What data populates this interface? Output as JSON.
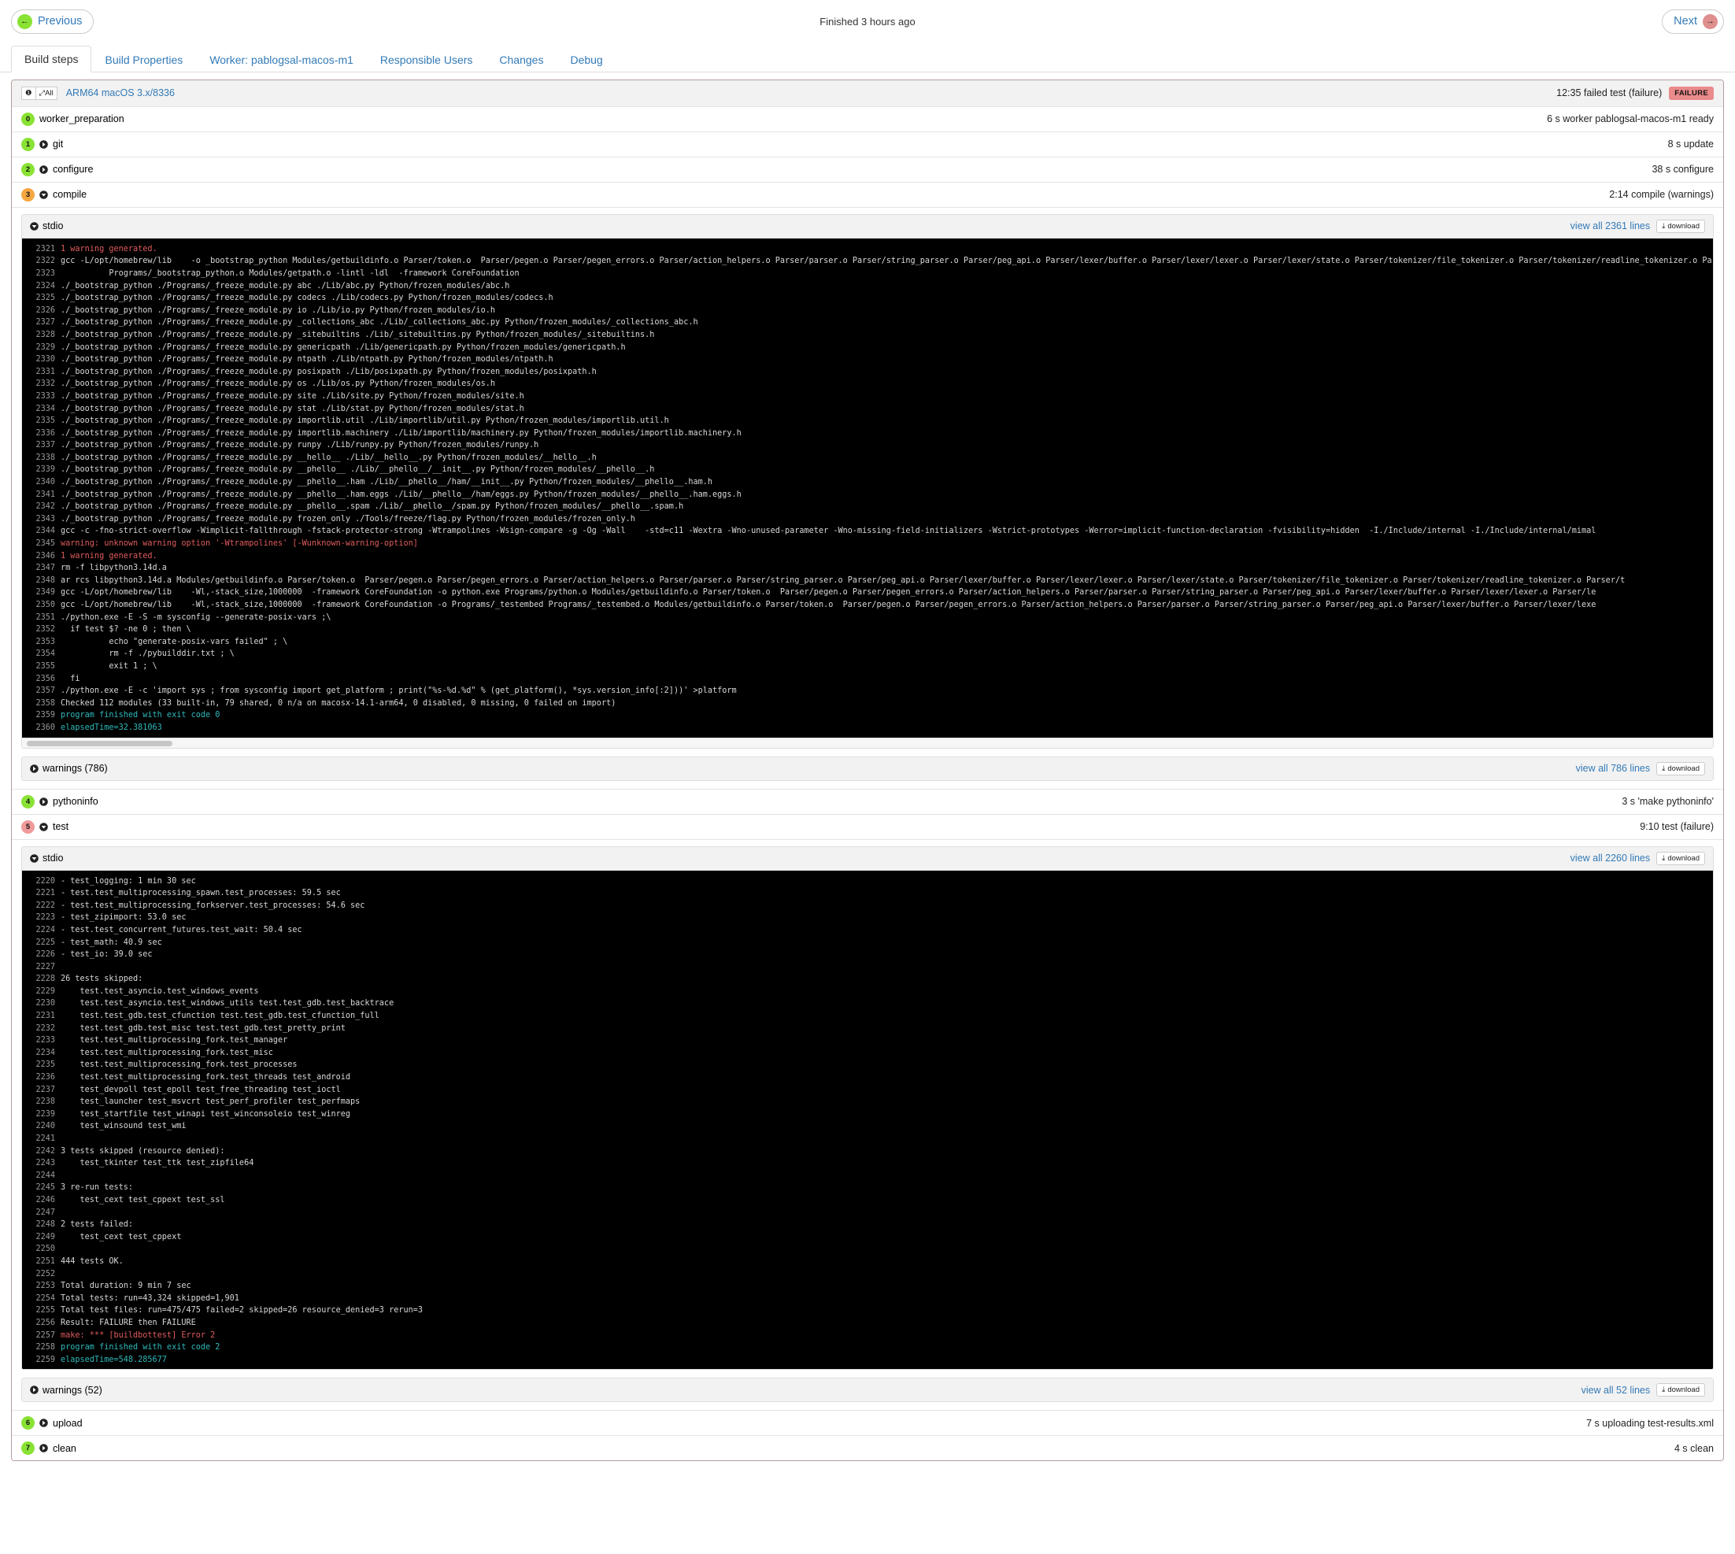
{
  "header": {
    "previous_label": "Previous",
    "next_label": "Next",
    "status": "Finished 3 hours ago"
  },
  "tabs": [
    {
      "label": "Build steps",
      "active": true
    },
    {
      "label": "Build Properties",
      "active": false
    },
    {
      "label": "Worker: pablogsal-macos-m1",
      "active": false
    },
    {
      "label": "Responsible Users",
      "active": false
    },
    {
      "label": "Changes",
      "active": false
    },
    {
      "label": "Debug",
      "active": false
    }
  ],
  "build": {
    "all_button": "All",
    "title": "ARM64 macOS 3.x/8336",
    "summary": "12:35 failed test (failure)",
    "status_badge": "FAILURE"
  },
  "steps": [
    {
      "num": "0",
      "color": "green",
      "name": "worker_preparation",
      "info": "6 s worker pablogsal-macos-m1 ready"
    },
    {
      "num": "1",
      "color": "green",
      "name": "git",
      "info": "8 s update"
    },
    {
      "num": "2",
      "color": "green",
      "name": "configure",
      "info": "38 s configure"
    },
    {
      "num": "3",
      "color": "orange",
      "name": "compile",
      "info": "2:14 compile (warnings)"
    },
    {
      "num": "4",
      "color": "green",
      "name": "pythoninfo",
      "info": "3 s 'make pythoninfo'"
    },
    {
      "num": "5",
      "color": "red",
      "name": "test",
      "info": "9:10 test (failure)"
    },
    {
      "num": "6",
      "color": "green",
      "name": "upload",
      "info": "7 s uploading test-results.xml"
    },
    {
      "num": "7",
      "color": "green",
      "name": "clean",
      "info": "4 s clean"
    }
  ],
  "compile_logs": {
    "stdio": {
      "title": "stdio",
      "view_all": "view all 2361 lines",
      "download": "download",
      "lines": [
        {
          "n": "2321",
          "c": "red",
          "t": "1 warning generated."
        },
        {
          "n": "2322",
          "c": "grey",
          "t": "gcc -L/opt/homebrew/lib    -o _bootstrap_python Modules/getbuildinfo.o Parser/token.o  Parser/pegen.o Parser/pegen_errors.o Parser/action_helpers.o Parser/parser.o Parser/string_parser.o Parser/peg_api.o Parser/lexer/buffer.o Parser/lexer/lexer.o Parser/lexer/state.o Parser/tokenizer/file_tokenizer.o Parser/tokenizer/readline_tokenizer.o Parser/toke"
        },
        {
          "n": "2323",
          "c": "grey",
          "t": "          Programs/_bootstrap_python.o Modules/getpath.o -lintl -ldl  -framework CoreFoundation"
        },
        {
          "n": "2324",
          "c": "grey",
          "t": "./_bootstrap_python ./Programs/_freeze_module.py abc ./Lib/abc.py Python/frozen_modules/abc.h"
        },
        {
          "n": "2325",
          "c": "grey",
          "t": "./_bootstrap_python ./Programs/_freeze_module.py codecs ./Lib/codecs.py Python/frozen_modules/codecs.h"
        },
        {
          "n": "2326",
          "c": "grey",
          "t": "./_bootstrap_python ./Programs/_freeze_module.py io ./Lib/io.py Python/frozen_modules/io.h"
        },
        {
          "n": "2327",
          "c": "grey",
          "t": "./_bootstrap_python ./Programs/_freeze_module.py _collections_abc ./Lib/_collections_abc.py Python/frozen_modules/_collections_abc.h"
        },
        {
          "n": "2328",
          "c": "grey",
          "t": "./_bootstrap_python ./Programs/_freeze_module.py _sitebuiltins ./Lib/_sitebuiltins.py Python/frozen_modules/_sitebuiltins.h"
        },
        {
          "n": "2329",
          "c": "grey",
          "t": "./_bootstrap_python ./Programs/_freeze_module.py genericpath ./Lib/genericpath.py Python/frozen_modules/genericpath.h"
        },
        {
          "n": "2330",
          "c": "grey",
          "t": "./_bootstrap_python ./Programs/_freeze_module.py ntpath ./Lib/ntpath.py Python/frozen_modules/ntpath.h"
        },
        {
          "n": "2331",
          "c": "grey",
          "t": "./_bootstrap_python ./Programs/_freeze_module.py posixpath ./Lib/posixpath.py Python/frozen_modules/posixpath.h"
        },
        {
          "n": "2332",
          "c": "grey",
          "t": "./_bootstrap_python ./Programs/_freeze_module.py os ./Lib/os.py Python/frozen_modules/os.h"
        },
        {
          "n": "2333",
          "c": "grey",
          "t": "./_bootstrap_python ./Programs/_freeze_module.py site ./Lib/site.py Python/frozen_modules/site.h"
        },
        {
          "n": "2334",
          "c": "grey",
          "t": "./_bootstrap_python ./Programs/_freeze_module.py stat ./Lib/stat.py Python/frozen_modules/stat.h"
        },
        {
          "n": "2335",
          "c": "grey",
          "t": "./_bootstrap_python ./Programs/_freeze_module.py importlib.util ./Lib/importlib/util.py Python/frozen_modules/importlib.util.h"
        },
        {
          "n": "2336",
          "c": "grey",
          "t": "./_bootstrap_python ./Programs/_freeze_module.py importlib.machinery ./Lib/importlib/machinery.py Python/frozen_modules/importlib.machinery.h"
        },
        {
          "n": "2337",
          "c": "grey",
          "t": "./_bootstrap_python ./Programs/_freeze_module.py runpy ./Lib/runpy.py Python/frozen_modules/runpy.h"
        },
        {
          "n": "2338",
          "c": "grey",
          "t": "./_bootstrap_python ./Programs/_freeze_module.py __hello__ ./Lib/__hello__.py Python/frozen_modules/__hello__.h"
        },
        {
          "n": "2339",
          "c": "grey",
          "t": "./_bootstrap_python ./Programs/_freeze_module.py __phello__ ./Lib/__phello__/__init__.py Python/frozen_modules/__phello__.h"
        },
        {
          "n": "2340",
          "c": "grey",
          "t": "./_bootstrap_python ./Programs/_freeze_module.py __phello__.ham ./Lib/__phello__/ham/__init__.py Python/frozen_modules/__phello__.ham.h"
        },
        {
          "n": "2341",
          "c": "grey",
          "t": "./_bootstrap_python ./Programs/_freeze_module.py __phello__.ham.eggs ./Lib/__phello__/ham/eggs.py Python/frozen_modules/__phello__.ham.eggs.h"
        },
        {
          "n": "2342",
          "c": "grey",
          "t": "./_bootstrap_python ./Programs/_freeze_module.py __phello__.spam ./Lib/__phello__/spam.py Python/frozen_modules/__phello__.spam.h"
        },
        {
          "n": "2343",
          "c": "grey",
          "t": "./_bootstrap_python ./Programs/_freeze_module.py frozen_only ./Tools/freeze/flag.py Python/frozen_modules/frozen_only.h"
        },
        {
          "n": "2344",
          "c": "grey",
          "t": "gcc -c -fno-strict-overflow -Wimplicit-fallthrough -fstack-protector-strong -Wtrampolines -Wsign-compare -g -Og -Wall    -std=c11 -Wextra -Wno-unused-parameter -Wno-missing-field-initializers -Wstrict-prototypes -Werror=implicit-function-declaration -fvisibility=hidden  -I./Include/internal -I./Include/internal/mimal"
        },
        {
          "n": "2345",
          "c": "red",
          "t": "warning: unknown warning option '-Wtrampolines' [-Wunknown-warning-option]"
        },
        {
          "n": "2346",
          "c": "red",
          "t": "1 warning generated."
        },
        {
          "n": "2347",
          "c": "grey",
          "t": "rm -f libpython3.14d.a"
        },
        {
          "n": "2348",
          "c": "grey",
          "t": "ar rcs libpython3.14d.a Modules/getbuildinfo.o Parser/token.o  Parser/pegen.o Parser/pegen_errors.o Parser/action_helpers.o Parser/parser.o Parser/string_parser.o Parser/peg_api.o Parser/lexer/buffer.o Parser/lexer/lexer.o Parser/lexer/state.o Parser/tokenizer/file_tokenizer.o Parser/tokenizer/readline_tokenizer.o Parser/t"
        },
        {
          "n": "2349",
          "c": "grey",
          "t": "gcc -L/opt/homebrew/lib    -Wl,-stack_size,1000000  -framework CoreFoundation -o python.exe Programs/python.o Modules/getbuildinfo.o Parser/token.o  Parser/pegen.o Parser/pegen_errors.o Parser/action_helpers.o Parser/parser.o Parser/string_parser.o Parser/peg_api.o Parser/lexer/buffer.o Parser/lexer/lexer.o Parser/le"
        },
        {
          "n": "2350",
          "c": "grey",
          "t": "gcc -L/opt/homebrew/lib    -Wl,-stack_size,1000000  -framework CoreFoundation -o Programs/_testembed Programs/_testembed.o Modules/getbuildinfo.o Parser/token.o  Parser/pegen.o Parser/pegen_errors.o Parser/action_helpers.o Parser/parser.o Parser/string_parser.o Parser/peg_api.o Parser/lexer/buffer.o Parser/lexer/lexe"
        },
        {
          "n": "2351",
          "c": "grey",
          "t": "./python.exe -E -S -m sysconfig --generate-posix-vars ;\\"
        },
        {
          "n": "2352",
          "c": "grey",
          "t": "  if test $? -ne 0 ; then \\"
        },
        {
          "n": "2353",
          "c": "grey",
          "t": "          echo \"generate-posix-vars failed\" ; \\"
        },
        {
          "n": "2354",
          "c": "grey",
          "t": "          rm -f ./pybuilddir.txt ; \\"
        },
        {
          "n": "2355",
          "c": "grey",
          "t": "          exit 1 ; \\"
        },
        {
          "n": "2356",
          "c": "grey",
          "t": "  fi"
        },
        {
          "n": "2357",
          "c": "grey",
          "t": "./python.exe -E -c 'import sys ; from sysconfig import get_platform ; print(\"%s-%d.%d\" % (get_platform(), *sys.version_info[:2]))' >platform"
        },
        {
          "n": "2358",
          "c": "grey",
          "t": "Checked 112 modules (33 built-in, 79 shared, 0 n/a on macosx-14.1-arm64, 0 disabled, 0 missing, 0 failed on import)"
        },
        {
          "n": "2359",
          "c": "cyan",
          "t": "program finished with exit code 0"
        },
        {
          "n": "2360",
          "c": "cyan",
          "t": "elapsedTime=32.381063"
        }
      ]
    },
    "warnings": {
      "title": "warnings (786)",
      "view_all": "view all 786 lines",
      "download": "download"
    }
  },
  "test_logs": {
    "stdio": {
      "title": "stdio",
      "view_all": "view all 2260 lines",
      "download": "download",
      "lines": [
        {
          "n": "2220",
          "c": "grey",
          "t": "- test_logging: 1 min 30 sec"
        },
        {
          "n": "2221",
          "c": "grey",
          "t": "- test.test_multiprocessing_spawn.test_processes: 59.5 sec"
        },
        {
          "n": "2222",
          "c": "grey",
          "t": "- test.test_multiprocessing_forkserver.test_processes: 54.6 sec"
        },
        {
          "n": "2223",
          "c": "grey",
          "t": "- test_zipimport: 53.0 sec"
        },
        {
          "n": "2224",
          "c": "grey",
          "t": "- test.test_concurrent_futures.test_wait: 50.4 sec"
        },
        {
          "n": "2225",
          "c": "grey",
          "t": "- test_math: 40.9 sec"
        },
        {
          "n": "2226",
          "c": "grey",
          "t": "- test_io: 39.0 sec"
        },
        {
          "n": "2227",
          "c": "grey",
          "t": ""
        },
        {
          "n": "2228",
          "c": "grey",
          "t": "26 tests skipped:"
        },
        {
          "n": "2229",
          "c": "grey",
          "t": "    test.test_asyncio.test_windows_events"
        },
        {
          "n": "2230",
          "c": "grey",
          "t": "    test.test_asyncio.test_windows_utils test.test_gdb.test_backtrace"
        },
        {
          "n": "2231",
          "c": "grey",
          "t": "    test.test_gdb.test_cfunction test.test_gdb.test_cfunction_full"
        },
        {
          "n": "2232",
          "c": "grey",
          "t": "    test.test_gdb.test_misc test.test_gdb.test_pretty_print"
        },
        {
          "n": "2233",
          "c": "grey",
          "t": "    test.test_multiprocessing_fork.test_manager"
        },
        {
          "n": "2234",
          "c": "grey",
          "t": "    test.test_multiprocessing_fork.test_misc"
        },
        {
          "n": "2235",
          "c": "grey",
          "t": "    test.test_multiprocessing_fork.test_processes"
        },
        {
          "n": "2236",
          "c": "grey",
          "t": "    test.test_multiprocessing_fork.test_threads test_android"
        },
        {
          "n": "2237",
          "c": "grey",
          "t": "    test_devpoll test_epoll test_free_threading test_ioctl"
        },
        {
          "n": "2238",
          "c": "grey",
          "t": "    test_launcher test_msvcrt test_perf_profiler test_perfmaps"
        },
        {
          "n": "2239",
          "c": "grey",
          "t": "    test_startfile test_winapi test_winconsoleio test_winreg"
        },
        {
          "n": "2240",
          "c": "grey",
          "t": "    test_winsound test_wmi"
        },
        {
          "n": "2241",
          "c": "grey",
          "t": ""
        },
        {
          "n": "2242",
          "c": "grey",
          "t": "3 tests skipped (resource denied):"
        },
        {
          "n": "2243",
          "c": "grey",
          "t": "    test_tkinter test_ttk test_zipfile64"
        },
        {
          "n": "2244",
          "c": "grey",
          "t": ""
        },
        {
          "n": "2245",
          "c": "grey",
          "t": "3 re-run tests:"
        },
        {
          "n": "2246",
          "c": "grey",
          "t": "    test_cext test_cppext test_ssl"
        },
        {
          "n": "2247",
          "c": "grey",
          "t": ""
        },
        {
          "n": "2248",
          "c": "grey",
          "t": "2 tests failed:"
        },
        {
          "n": "2249",
          "c": "grey",
          "t": "    test_cext test_cppext"
        },
        {
          "n": "2250",
          "c": "grey",
          "t": ""
        },
        {
          "n": "2251",
          "c": "grey",
          "t": "444 tests OK."
        },
        {
          "n": "2252",
          "c": "grey",
          "t": ""
        },
        {
          "n": "2253",
          "c": "grey",
          "t": "Total duration: 9 min 7 sec"
        },
        {
          "n": "2254",
          "c": "grey",
          "t": "Total tests: run=43,324 skipped=1,901"
        },
        {
          "n": "2255",
          "c": "grey",
          "t": "Total test files: run=475/475 failed=2 skipped=26 resource_denied=3 rerun=3"
        },
        {
          "n": "2256",
          "c": "grey",
          "t": "Result: FAILURE then FAILURE"
        },
        {
          "n": "2257",
          "c": "red",
          "t": "make: *** [buildbottest] Error 2"
        },
        {
          "n": "2258",
          "c": "cyan",
          "t": "program finished with exit code 2"
        },
        {
          "n": "2259",
          "c": "cyan",
          "t": "elapsedTime=548.285677"
        }
      ]
    },
    "warnings": {
      "title": "warnings (52)",
      "view_all": "view all 52 lines",
      "download": "download"
    }
  },
  "icons": {
    "arrow_left": "arrow-left-icon",
    "arrow_right": "arrow-right-icon",
    "chevron_right": "chevron-right-icon",
    "chevron_down": "chevron-down-icon",
    "expand": "expand-icon",
    "download": "download-icon"
  },
  "colors": {
    "link": "#337ab7",
    "success": "#89e234",
    "warning": "#f5a742",
    "failure": "#ea8a8a",
    "terminal_bg": "#000000",
    "terminal_red": "#e05c5c",
    "terminal_cyan": "#2fb9ba"
  }
}
